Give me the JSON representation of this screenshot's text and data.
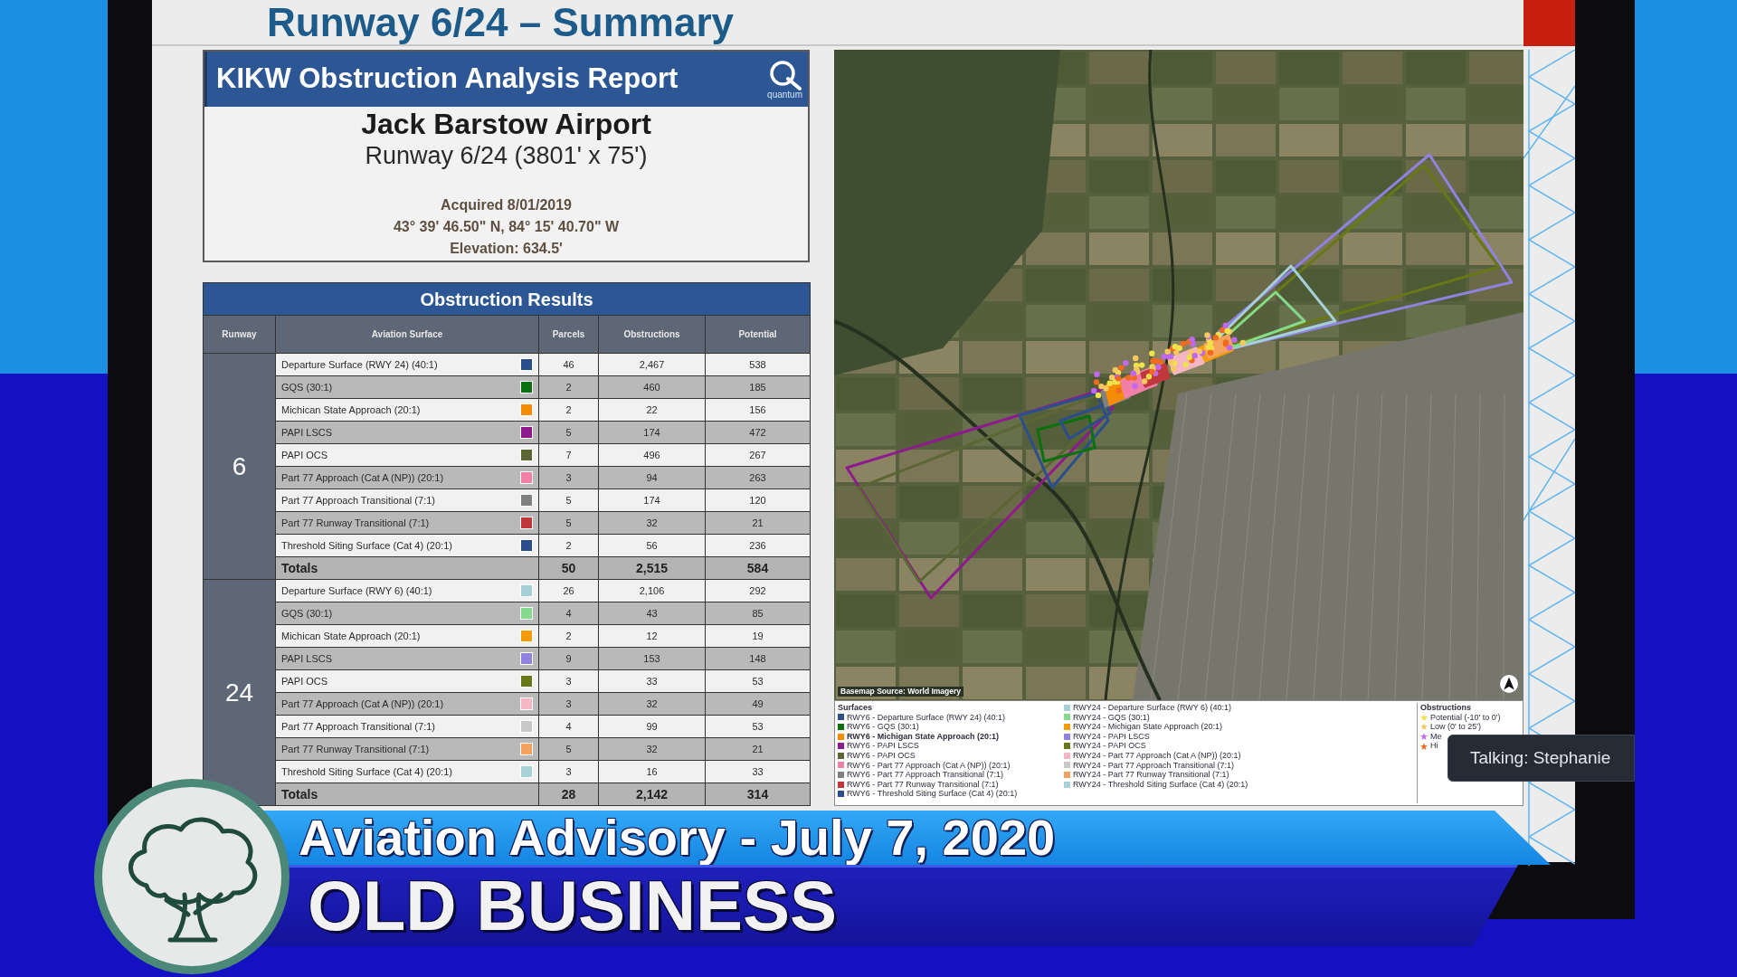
{
  "slide": {
    "title": "Runway 6/24 – Summary"
  },
  "report": {
    "title": "KIKW Obstruction Analysis Report",
    "logo_text": "quantum",
    "airport": "Jack Barstow Airport",
    "runway": "Runway 6/24 (3801' x 75')",
    "details": [
      "Acquired 8/01/2019",
      "43° 39' 46.50\" N, 84° 15' 40.70\" W",
      "Elevation: 634.5'"
    ]
  },
  "results": {
    "title": "Obstruction Results",
    "columns": [
      "Runway",
      "Aviation Surface",
      "Parcels",
      "Obstructions",
      "Potential"
    ],
    "groups": [
      {
        "runway": "6",
        "rows": [
          {
            "surface": "Departure Surface (RWY 24) (40:1)",
            "color": "#2b4f8a",
            "parcels": "46",
            "obstructions": "2,467",
            "potential": "538"
          },
          {
            "surface": "GQS (30:1)",
            "color": "#0a7010",
            "parcels": "2",
            "obstructions": "460",
            "potential": "185"
          },
          {
            "surface": "Michican State Approach (20:1)",
            "color": "#f48c06",
            "parcels": "2",
            "obstructions": "22",
            "potential": "156"
          },
          {
            "surface": "PAPI LSCS",
            "color": "#8e1a8e",
            "parcels": "5",
            "obstructions": "174",
            "potential": "472"
          },
          {
            "surface": "PAPI OCS",
            "color": "#5b6634",
            "parcels": "7",
            "obstructions": "496",
            "potential": "267"
          },
          {
            "surface": "Part 77 Approach (Cat A (NP)) (20:1)",
            "color": "#f080a8",
            "parcels": "3",
            "obstructions": "94",
            "potential": "263"
          },
          {
            "surface": "Part 77 Approach Transitional (7:1)",
            "color": "#808080",
            "parcels": "5",
            "obstructions": "174",
            "potential": "120"
          },
          {
            "surface": "Part 77 Runway Transitional (7:1)",
            "color": "#c0383c",
            "parcels": "5",
            "obstructions": "32",
            "potential": "21"
          },
          {
            "surface": "Threshold Siting Surface (Cat 4) (20:1)",
            "color": "#2d4d8c",
            "parcels": "2",
            "obstructions": "56",
            "potential": "236"
          }
        ],
        "totals": {
          "label": "Totals",
          "parcels": "50",
          "obstructions": "2,515",
          "potential": "584"
        }
      },
      {
        "runway": "24",
        "rows": [
          {
            "surface": "Departure Surface (RWY 6) (40:1)",
            "color": "#a6d0d6",
            "parcels": "26",
            "obstructions": "2,106",
            "potential": "292"
          },
          {
            "surface": "GQS (30:1)",
            "color": "#86da8c",
            "parcels": "4",
            "obstructions": "43",
            "potential": "85"
          },
          {
            "surface": "Michican State Approach (20:1)",
            "color": "#f59c00",
            "parcels": "2",
            "obstructions": "12",
            "potential": "19"
          },
          {
            "surface": "PAPI LSCS",
            "color": "#9083e0",
            "parcels": "9",
            "obstructions": "153",
            "potential": "148"
          },
          {
            "surface": "PAPI OCS",
            "color": "#687818",
            "parcels": "3",
            "obstructions": "33",
            "potential": "53"
          },
          {
            "surface": "Part 77 Approach (Cat A (NP)) (20:1)",
            "color": "#f4b6c2",
            "parcels": "3",
            "obstructions": "32",
            "potential": "49"
          },
          {
            "surface": "Part 77 Approach Transitional (7:1)",
            "color": "#c9c9c9",
            "parcels": "4",
            "obstructions": "99",
            "potential": "53"
          },
          {
            "surface": "Part 77 Runway Transitional (7:1)",
            "color": "#f4a25e",
            "parcels": "5",
            "obstructions": "32",
            "potential": "21"
          },
          {
            "surface": "Threshold Siting Surface (Cat 4) (20:1)",
            "color": "#a8d2d6",
            "parcels": "3",
            "obstructions": "16",
            "potential": "33"
          }
        ],
        "totals": {
          "label": "Totals",
          "parcels": "28",
          "obstructions": "2,142",
          "potential": "314"
        }
      }
    ]
  },
  "map": {
    "source": "Basemap Source: World Imagery",
    "legend": {
      "surfaces_title": "Surfaces",
      "surface_columns": [
        {
          "items": [
            {
              "label": "RWY6 - Departure Surface (RWY 24) (40:1)",
              "color": "#2b4f8a",
              "bold": false
            },
            {
              "label": "RWY6 - GQS (30:1)",
              "color": "#0a7010",
              "bold": false
            },
            {
              "label": "RWY6 - Michigan State Approach (20:1)",
              "color": "#f48c06",
              "bold": true
            },
            {
              "label": "RWY6 - PAPI LSCS",
              "color": "#8e1a8e",
              "bold": false
            },
            {
              "label": "RWY6 - PAPI OCS",
              "color": "#5b6634",
              "bold": false
            },
            {
              "label": "RWY6 - Part 77 Approach (Cat A (NP)) (20:1)",
              "color": "#f080a8",
              "bold": false
            },
            {
              "label": "RWY6 - Part 77 Approach Transitional (7:1)",
              "color": "#808080",
              "bold": false
            },
            {
              "label": "RWY6 - Part 77 Runway Transitional (7:1)",
              "color": "#c0383c",
              "bold": false
            },
            {
              "label": "RWY6 - Threshold Siting Surface (Cat 4) (20:1)",
              "color": "#2d4d8c",
              "bold": false
            }
          ]
        },
        {
          "items": [
            {
              "label": "RWY24 - Departure Surface (RWY 6) (40:1)",
              "color": "#a6d0d6",
              "bold": false
            },
            {
              "label": "RWY24 - GQS (30:1)",
              "color": "#86da8c",
              "bold": false
            },
            {
              "label": "RWY24 - Michigan State Approach (20:1)",
              "color": "#f59c00",
              "bold": false
            },
            {
              "label": "RWY24 - PAPI LSCS",
              "color": "#9083e0",
              "bold": false
            },
            {
              "label": "RWY24 - PAPI OCS",
              "color": "#687818",
              "bold": false
            },
            {
              "label": "RWY24 - Part 77 Approach (Cat A (NP)) (20:1)",
              "color": "#f4b6c2",
              "bold": false
            },
            {
              "label": "RWY24 - Part 77 Approach Transitional (7:1)",
              "color": "#c9c9c9",
              "bold": false
            },
            {
              "label": "RWY24 - Part 77 Runway Transitional (7:1)",
              "color": "#f4a25e",
              "bold": false
            },
            {
              "label": "RWY24 - Threshold Siting Surface (Cat 4) (20:1)",
              "color": "#a8d2d6",
              "bold": false
            }
          ]
        }
      ],
      "obstructions_title": "Obstructions",
      "obstructions": [
        {
          "label": "Potential (-10' to 0')",
          "color": "#f2e24a"
        },
        {
          "label": "Low (0' to 25')",
          "color": "#f6c860"
        },
        {
          "label": "Me",
          "color": "#c068f0"
        },
        {
          "label": "Hi",
          "color": "#f06a20"
        }
      ]
    }
  },
  "speaker": {
    "label": "Talking: Stephanie"
  },
  "banner": {
    "title": "Aviation Advisory - July 7, 2020",
    "section": "OLD BUSINESS"
  }
}
